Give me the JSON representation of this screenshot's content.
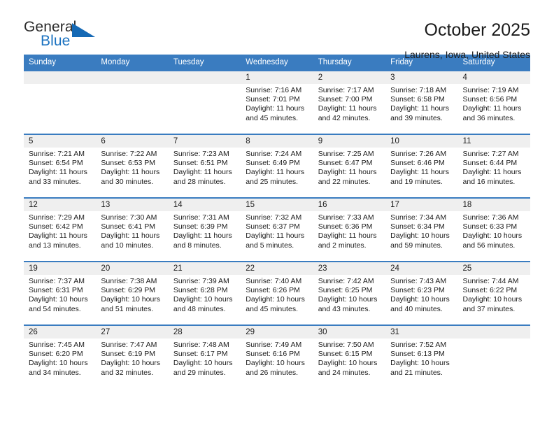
{
  "brand": {
    "name_top": "General",
    "name_bottom": "Blue",
    "accent_color": "#1569b5",
    "triangle_icon": "triangle-icon"
  },
  "header": {
    "title": "October 2025",
    "subtitle": "Laurens, Iowa, United States"
  },
  "theme": {
    "header_blue": "#3a7cc0",
    "daynum_band": "#efefef",
    "text": "#1b1b1b"
  },
  "calendar": {
    "weekday_headers": [
      "Sunday",
      "Monday",
      "Tuesday",
      "Wednesday",
      "Thursday",
      "Friday",
      "Saturday"
    ],
    "weeks": [
      [
        {
          "day": "",
          "sunrise": "",
          "sunset": "",
          "daylight_line1": "",
          "daylight_line2": "",
          "empty": true
        },
        {
          "day": "",
          "sunrise": "",
          "sunset": "",
          "daylight_line1": "",
          "daylight_line2": "",
          "empty": true
        },
        {
          "day": "",
          "sunrise": "",
          "sunset": "",
          "daylight_line1": "",
          "daylight_line2": "",
          "empty": true
        },
        {
          "day": "1",
          "sunrise": "Sunrise: 7:16 AM",
          "sunset": "Sunset: 7:01 PM",
          "daylight_line1": "Daylight: 11 hours",
          "daylight_line2": "and 45 minutes.",
          "empty": false
        },
        {
          "day": "2",
          "sunrise": "Sunrise: 7:17 AM",
          "sunset": "Sunset: 7:00 PM",
          "daylight_line1": "Daylight: 11 hours",
          "daylight_line2": "and 42 minutes.",
          "empty": false
        },
        {
          "day": "3",
          "sunrise": "Sunrise: 7:18 AM",
          "sunset": "Sunset: 6:58 PM",
          "daylight_line1": "Daylight: 11 hours",
          "daylight_line2": "and 39 minutes.",
          "empty": false
        },
        {
          "day": "4",
          "sunrise": "Sunrise: 7:19 AM",
          "sunset": "Sunset: 6:56 PM",
          "daylight_line1": "Daylight: 11 hours",
          "daylight_line2": "and 36 minutes.",
          "empty": false
        }
      ],
      [
        {
          "day": "5",
          "sunrise": "Sunrise: 7:21 AM",
          "sunset": "Sunset: 6:54 PM",
          "daylight_line1": "Daylight: 11 hours",
          "daylight_line2": "and 33 minutes.",
          "empty": false
        },
        {
          "day": "6",
          "sunrise": "Sunrise: 7:22 AM",
          "sunset": "Sunset: 6:53 PM",
          "daylight_line1": "Daylight: 11 hours",
          "daylight_line2": "and 30 minutes.",
          "empty": false
        },
        {
          "day": "7",
          "sunrise": "Sunrise: 7:23 AM",
          "sunset": "Sunset: 6:51 PM",
          "daylight_line1": "Daylight: 11 hours",
          "daylight_line2": "and 28 minutes.",
          "empty": false
        },
        {
          "day": "8",
          "sunrise": "Sunrise: 7:24 AM",
          "sunset": "Sunset: 6:49 PM",
          "daylight_line1": "Daylight: 11 hours",
          "daylight_line2": "and 25 minutes.",
          "empty": false
        },
        {
          "day": "9",
          "sunrise": "Sunrise: 7:25 AM",
          "sunset": "Sunset: 6:47 PM",
          "daylight_line1": "Daylight: 11 hours",
          "daylight_line2": "and 22 minutes.",
          "empty": false
        },
        {
          "day": "10",
          "sunrise": "Sunrise: 7:26 AM",
          "sunset": "Sunset: 6:46 PM",
          "daylight_line1": "Daylight: 11 hours",
          "daylight_line2": "and 19 minutes.",
          "empty": false
        },
        {
          "day": "11",
          "sunrise": "Sunrise: 7:27 AM",
          "sunset": "Sunset: 6:44 PM",
          "daylight_line1": "Daylight: 11 hours",
          "daylight_line2": "and 16 minutes.",
          "empty": false
        }
      ],
      [
        {
          "day": "12",
          "sunrise": "Sunrise: 7:29 AM",
          "sunset": "Sunset: 6:42 PM",
          "daylight_line1": "Daylight: 11 hours",
          "daylight_line2": "and 13 minutes.",
          "empty": false
        },
        {
          "day": "13",
          "sunrise": "Sunrise: 7:30 AM",
          "sunset": "Sunset: 6:41 PM",
          "daylight_line1": "Daylight: 11 hours",
          "daylight_line2": "and 10 minutes.",
          "empty": false
        },
        {
          "day": "14",
          "sunrise": "Sunrise: 7:31 AM",
          "sunset": "Sunset: 6:39 PM",
          "daylight_line1": "Daylight: 11 hours",
          "daylight_line2": "and 8 minutes.",
          "empty": false
        },
        {
          "day": "15",
          "sunrise": "Sunrise: 7:32 AM",
          "sunset": "Sunset: 6:37 PM",
          "daylight_line1": "Daylight: 11 hours",
          "daylight_line2": "and 5 minutes.",
          "empty": false
        },
        {
          "day": "16",
          "sunrise": "Sunrise: 7:33 AM",
          "sunset": "Sunset: 6:36 PM",
          "daylight_line1": "Daylight: 11 hours",
          "daylight_line2": "and 2 minutes.",
          "empty": false
        },
        {
          "day": "17",
          "sunrise": "Sunrise: 7:34 AM",
          "sunset": "Sunset: 6:34 PM",
          "daylight_line1": "Daylight: 10 hours",
          "daylight_line2": "and 59 minutes.",
          "empty": false
        },
        {
          "day": "18",
          "sunrise": "Sunrise: 7:36 AM",
          "sunset": "Sunset: 6:33 PM",
          "daylight_line1": "Daylight: 10 hours",
          "daylight_line2": "and 56 minutes.",
          "empty": false
        }
      ],
      [
        {
          "day": "19",
          "sunrise": "Sunrise: 7:37 AM",
          "sunset": "Sunset: 6:31 PM",
          "daylight_line1": "Daylight: 10 hours",
          "daylight_line2": "and 54 minutes.",
          "empty": false
        },
        {
          "day": "20",
          "sunrise": "Sunrise: 7:38 AM",
          "sunset": "Sunset: 6:29 PM",
          "daylight_line1": "Daylight: 10 hours",
          "daylight_line2": "and 51 minutes.",
          "empty": false
        },
        {
          "day": "21",
          "sunrise": "Sunrise: 7:39 AM",
          "sunset": "Sunset: 6:28 PM",
          "daylight_line1": "Daylight: 10 hours",
          "daylight_line2": "and 48 minutes.",
          "empty": false
        },
        {
          "day": "22",
          "sunrise": "Sunrise: 7:40 AM",
          "sunset": "Sunset: 6:26 PM",
          "daylight_line1": "Daylight: 10 hours",
          "daylight_line2": "and 45 minutes.",
          "empty": false
        },
        {
          "day": "23",
          "sunrise": "Sunrise: 7:42 AM",
          "sunset": "Sunset: 6:25 PM",
          "daylight_line1": "Daylight: 10 hours",
          "daylight_line2": "and 43 minutes.",
          "empty": false
        },
        {
          "day": "24",
          "sunrise": "Sunrise: 7:43 AM",
          "sunset": "Sunset: 6:23 PM",
          "daylight_line1": "Daylight: 10 hours",
          "daylight_line2": "and 40 minutes.",
          "empty": false
        },
        {
          "day": "25",
          "sunrise": "Sunrise: 7:44 AM",
          "sunset": "Sunset: 6:22 PM",
          "daylight_line1": "Daylight: 10 hours",
          "daylight_line2": "and 37 minutes.",
          "empty": false
        }
      ],
      [
        {
          "day": "26",
          "sunrise": "Sunrise: 7:45 AM",
          "sunset": "Sunset: 6:20 PM",
          "daylight_line1": "Daylight: 10 hours",
          "daylight_line2": "and 34 minutes.",
          "empty": false
        },
        {
          "day": "27",
          "sunrise": "Sunrise: 7:47 AM",
          "sunset": "Sunset: 6:19 PM",
          "daylight_line1": "Daylight: 10 hours",
          "daylight_line2": "and 32 minutes.",
          "empty": false
        },
        {
          "day": "28",
          "sunrise": "Sunrise: 7:48 AM",
          "sunset": "Sunset: 6:17 PM",
          "daylight_line1": "Daylight: 10 hours",
          "daylight_line2": "and 29 minutes.",
          "empty": false
        },
        {
          "day": "29",
          "sunrise": "Sunrise: 7:49 AM",
          "sunset": "Sunset: 6:16 PM",
          "daylight_line1": "Daylight: 10 hours",
          "daylight_line2": "and 26 minutes.",
          "empty": false
        },
        {
          "day": "30",
          "sunrise": "Sunrise: 7:50 AM",
          "sunset": "Sunset: 6:15 PM",
          "daylight_line1": "Daylight: 10 hours",
          "daylight_line2": "and 24 minutes.",
          "empty": false
        },
        {
          "day": "31",
          "sunrise": "Sunrise: 7:52 AM",
          "sunset": "Sunset: 6:13 PM",
          "daylight_line1": "Daylight: 10 hours",
          "daylight_line2": "and 21 minutes.",
          "empty": false
        },
        {
          "day": "",
          "sunrise": "",
          "sunset": "",
          "daylight_line1": "",
          "daylight_line2": "",
          "empty": true
        }
      ]
    ]
  }
}
